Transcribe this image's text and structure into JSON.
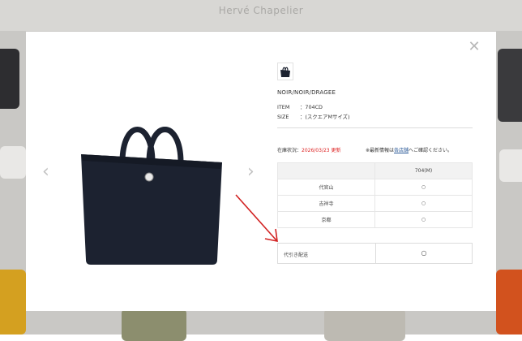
{
  "background": {
    "logo": "Hervé Chapelier"
  },
  "modal": {
    "close_icon": "close-icon",
    "prev_icon": "chevron-left-icon",
    "next_icon": "chevron-right-icon",
    "color_name": "NOIR/NOIR/DRAGEE",
    "specs": [
      {
        "key": "ITEM",
        "value": "：704CD"
      },
      {
        "key": "SIZE",
        "value": "：(スクエアMサイズ)"
      }
    ],
    "stock_status": {
      "label": "在庫状況：",
      "date": "2026/03/23 更新"
    },
    "note": {
      "prefix": "※最新情報は",
      "link": "各店舗",
      "suffix": "へご確認ください。"
    },
    "stock_table": {
      "header": "704(M)",
      "rows": [
        {
          "store": "代官山",
          "mark": "○"
        },
        {
          "store": "吉祥寺",
          "mark": "○"
        },
        {
          "store": "京都",
          "mark": "○"
        }
      ]
    },
    "cod": {
      "label": "代引き配送",
      "mark": "○"
    }
  },
  "colors": {
    "accent_red": "#d22222",
    "link_blue": "#2f5d9a",
    "bag_navy": "#1c2230"
  }
}
